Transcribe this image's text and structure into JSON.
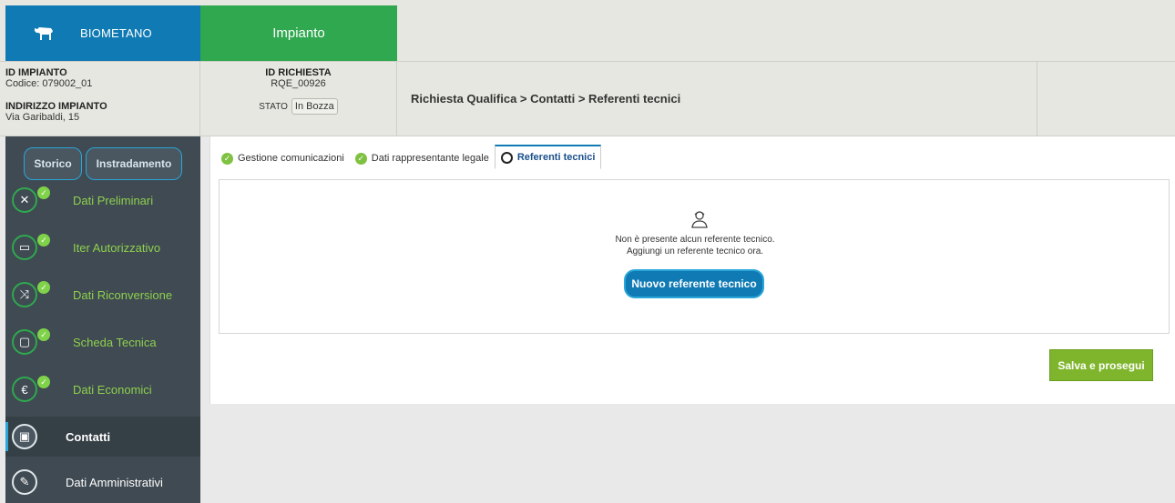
{
  "header": {
    "brand": "BIOMETANO",
    "app_tab": "Impianto"
  },
  "info": {
    "id_impianto_label": "ID IMPIANTO",
    "id_impianto_value": "Codice: 079002_01",
    "indirizzo_label": "INDIRIZZO IMPIANTO",
    "indirizzo_value": "Via Garibaldi, 15",
    "id_richiesta_label": "ID RICHIESTA",
    "id_richiesta_value": "RQE_00926",
    "stato_label": "STATO",
    "stato_value": "In Bozza",
    "breadcrumb": "Richiesta Qualifica > Contatti > Referenti tecnici"
  },
  "sidebar": {
    "storico": "Storico",
    "instradamento": "Instradamento",
    "items": [
      {
        "label": "Dati Preliminari",
        "icon": "tools-icon",
        "done": true
      },
      {
        "label": "Iter Autorizzativo",
        "icon": "factory-icon",
        "done": true
      },
      {
        "label": "Dati Riconversione",
        "icon": "shuffle-icon",
        "done": true
      },
      {
        "label": "Scheda Tecnica",
        "icon": "tablet-icon",
        "done": true
      },
      {
        "label": "Dati Economici",
        "icon": "euro-icon",
        "done": true
      },
      {
        "label": "Contatti",
        "icon": "contacts-icon",
        "done": false
      },
      {
        "label": "Dati Amministrativi",
        "icon": "wrench-icon",
        "done": false
      }
    ]
  },
  "tabs": [
    {
      "label": "Gestione comunicazioni",
      "done": true
    },
    {
      "label": "Dati rappresentante legale",
      "done": true
    },
    {
      "label": "Referenti tecnici",
      "done": false
    }
  ],
  "empty_state": {
    "line1": "Non è presente alcun referente tecnico.",
    "line2": "Aggiungi un referente tecnico ora.",
    "button": "Nuovo referente tecnico"
  },
  "actions": {
    "save": "Salva e prosegui"
  },
  "colors": {
    "brand_blue": "#0f7ab4",
    "green": "#2fa84f",
    "sidebar": "#3f4a52",
    "save_green": "#7fb52c"
  }
}
